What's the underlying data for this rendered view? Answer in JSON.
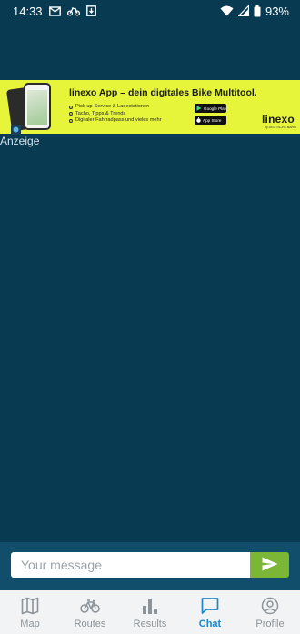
{
  "status": {
    "time": "14:33",
    "battery": "93%"
  },
  "ad": {
    "title": "linexo App – dein digitales Bike Multitool.",
    "features": [
      "Pick-up-Service & Ladestationen",
      "Tacho, Tipps & Trends",
      "Digitaler Fahrradpass und vieles mehr"
    ],
    "google_play_label": "Google Play",
    "app_store_label": "App Store",
    "logo_text": "linexo",
    "logo_sub": "by DEUTSCHE BAHN",
    "label": "Anzeige"
  },
  "chat": {
    "placeholder": "Your message"
  },
  "nav": {
    "items": [
      {
        "label": "Map",
        "icon": "map-icon"
      },
      {
        "label": "Routes",
        "icon": "bike-icon"
      },
      {
        "label": "Results",
        "icon": "bar-chart-icon"
      },
      {
        "label": "Chat",
        "icon": "chat-icon",
        "active": true
      },
      {
        "label": "Profile",
        "icon": "profile-icon"
      }
    ]
  },
  "colors": {
    "background": "#083a52",
    "ad_background": "#e6f53a",
    "send_button": "#7cb637",
    "nav_active": "#1c86c8",
    "nav_inactive": "#8c949a"
  }
}
